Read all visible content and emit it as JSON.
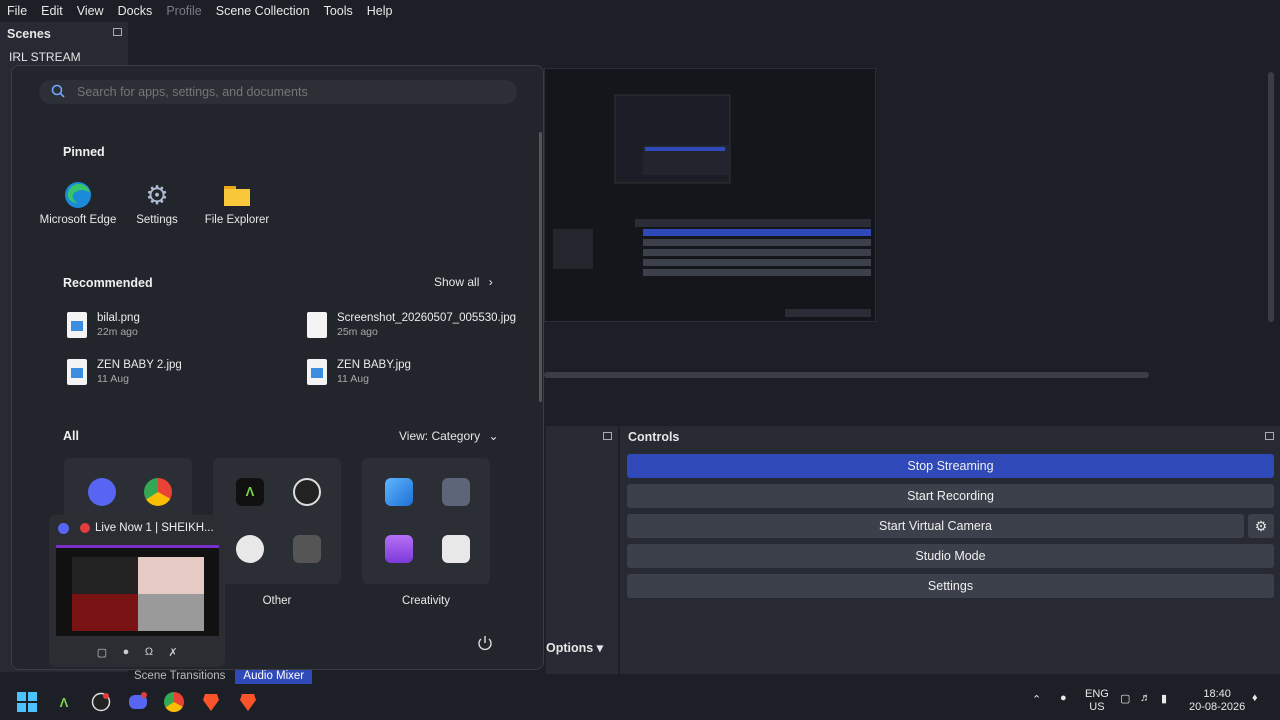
{
  "menubar": {
    "items": [
      {
        "label": "File",
        "enabled": true
      },
      {
        "label": "Edit",
        "enabled": true
      },
      {
        "label": "View",
        "enabled": true
      },
      {
        "label": "Docks",
        "enabled": true
      },
      {
        "label": "Profile",
        "enabled": false
      },
      {
        "label": "Scene Collection",
        "enabled": true
      },
      {
        "label": "Tools",
        "enabled": true
      },
      {
        "label": "Help",
        "enabled": true
      }
    ]
  },
  "scenes": {
    "title": "Scenes",
    "items": [
      "IRL STREAM"
    ]
  },
  "controls": {
    "title": "Controls",
    "stop_streaming": "Stop Streaming",
    "start_recording": "Start Recording",
    "start_virtual_camera": "Start Virtual Camera",
    "studio_mode": "Studio Mode",
    "settings": "Settings"
  },
  "mixer": {
    "options": "Options"
  },
  "bottom_tabs": {
    "scene_transitions": "Scene Transitions",
    "audio_mixer": "Audio Mixer"
  },
  "start_menu": {
    "search_placeholder": "Search for apps, settings, and documents",
    "pinned_title": "Pinned",
    "pinned": [
      {
        "label": "Microsoft Edge",
        "icon": "edge-icon"
      },
      {
        "label": "Settings",
        "icon": "settings-gear-icon"
      },
      {
        "label": "File Explorer",
        "icon": "folder-icon"
      }
    ],
    "recommended_title": "Recommended",
    "show_all": "Show all",
    "recommended": [
      {
        "name": "bilal.png",
        "time": "22m ago"
      },
      {
        "name": "Screenshot_20260507_005530.jpg",
        "time": "25m ago"
      },
      {
        "name": "ZEN BABY 2.jpg",
        "time": "11 Aug"
      },
      {
        "name": "ZEN BABY.jpg",
        "time": "11 Aug"
      }
    ],
    "all_title": "All",
    "view_label": "View: Category",
    "categories": [
      {
        "label": "Other"
      },
      {
        "label": "Creativity"
      }
    ]
  },
  "discord_popup": {
    "title": "Live Now 1 | SHEIKH..."
  },
  "tray": {
    "lang_top": "ENG",
    "lang_bottom": "US",
    "time": "18:40",
    "date": "20-08-2026"
  },
  "colors": {
    "accent": "#2f49b8",
    "panel": "#272a33",
    "start_bg": "#22252b"
  }
}
